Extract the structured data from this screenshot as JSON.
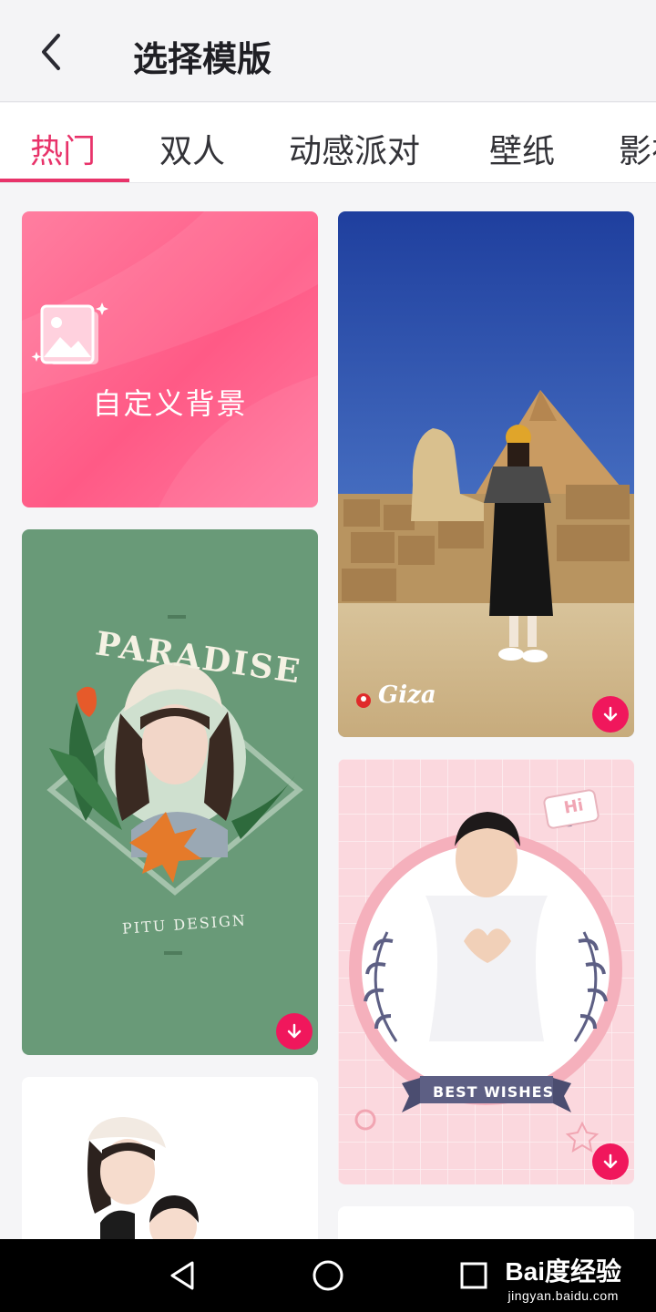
{
  "header": {
    "back_icon": "chevron-left-icon",
    "title": "选择模版"
  },
  "tabs": [
    {
      "label": "热门",
      "active": true
    },
    {
      "label": "双人",
      "active": false
    },
    {
      "label": "动感派对",
      "active": false
    },
    {
      "label": "壁纸",
      "active": false
    },
    {
      "label": "影视",
      "active": false
    }
  ],
  "templates": {
    "custom": {
      "label": "自定义背景",
      "icon": "image-icon"
    },
    "giza": {
      "caption": "Giza",
      "download_icon": "download-icon"
    },
    "paradise": {
      "title": "PARADISE",
      "subtitle": "PITU DESIGN",
      "download_icon": "download-icon"
    },
    "best_wishes": {
      "bubble": "Hi",
      "ribbon": "BEST WISHES",
      "download_icon": "download-icon"
    }
  },
  "colors": {
    "accent": "#e8336a",
    "download": "#f0175c"
  },
  "system_nav": {
    "back_icon": "triangle-back-icon",
    "home_icon": "circle-home-icon",
    "recents_icon": "square-recents-icon"
  },
  "watermark": {
    "brand": "Bai度经验",
    "url": "jingyan.baidu.com"
  }
}
